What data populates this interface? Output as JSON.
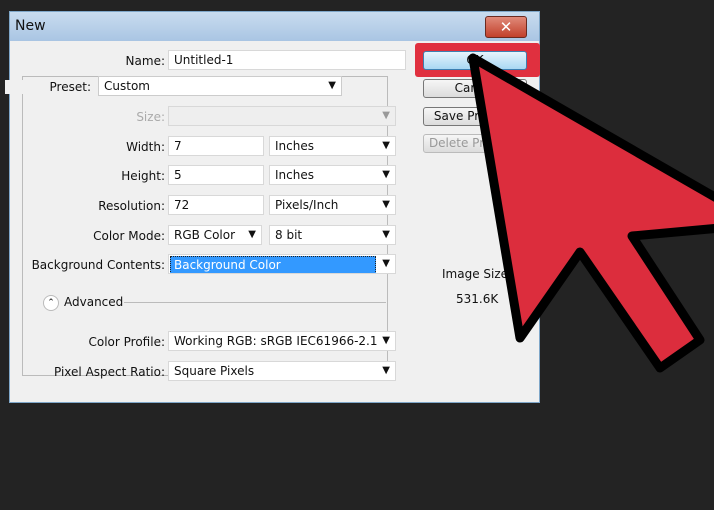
{
  "dialog": {
    "title": "New",
    "close_icon": "close-icon"
  },
  "fields": {
    "name": {
      "label": "Name:",
      "value": "Untitled-1"
    },
    "preset": {
      "label": "Preset:",
      "value": "Custom"
    },
    "size": {
      "label": "Size:",
      "value": ""
    },
    "width": {
      "label": "Width:",
      "value": "7",
      "unit": "Inches"
    },
    "height": {
      "label": "Height:",
      "value": "5",
      "unit": "Inches"
    },
    "resolution": {
      "label": "Resolution:",
      "value": "72",
      "unit": "Pixels/Inch"
    },
    "color_mode": {
      "label": "Color Mode:",
      "value": "RGB Color",
      "depth": "8 bit"
    },
    "background": {
      "label": "Background Contents:",
      "value": "Background Color"
    },
    "advanced": {
      "label": "Advanced"
    },
    "color_profile": {
      "label": "Color Profile:",
      "value": "Working RGB:  sRGB IEC61966-2.1"
    },
    "pixel_aspect": {
      "label": "Pixel Aspect Ratio:",
      "value": "Square Pixels"
    }
  },
  "buttons": {
    "ok": "OK",
    "cancel": "Cancel",
    "save_preset": "Save Preset...",
    "delete_preset": "Delete Preset..."
  },
  "image_size": {
    "label": "Image Size:",
    "value": "531.6K"
  },
  "colors": {
    "highlight": "#e0303f",
    "arrow": "#dc2d3d",
    "selection": "#3399ff"
  }
}
